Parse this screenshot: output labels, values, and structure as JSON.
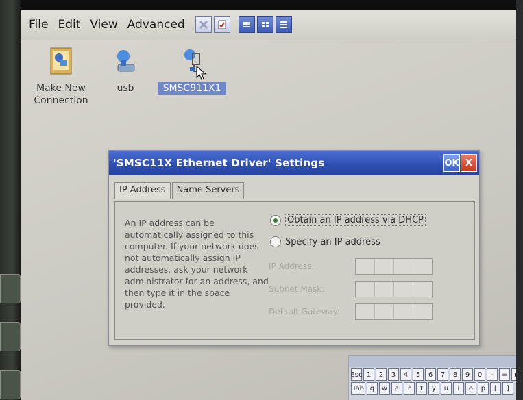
{
  "menubar": {
    "items": [
      "File",
      "Edit",
      "View",
      "Advanced"
    ]
  },
  "toolbar": {
    "buttons": [
      "delete-icon",
      "properties-icon",
      "large-icons-view-icon",
      "small-icons-view-icon",
      "details-view-icon"
    ]
  },
  "desktop_icons": [
    {
      "label": "Make New Connection",
      "icon": "make-new-connection-icon",
      "selected": false
    },
    {
      "label": "usb",
      "icon": "usb-connection-icon",
      "selected": false
    },
    {
      "label": "SMSC911X1",
      "icon": "network-adapter-icon",
      "selected": true
    }
  ],
  "dialog": {
    "title": "'SMSC11X Ethernet Driver' Settings",
    "ok_label": "OK",
    "close_label": "X",
    "tabs": [
      "IP Address",
      "Name Servers"
    ],
    "active_tab": "IP Address",
    "description": "An IP address can be automatically assigned to this computer.  If your network does not automatically assign IP addresses, ask your network administrator for an address, and then type it in the space provided.",
    "options": [
      {
        "label": "Obtain an IP address via DHCP",
        "selected": true
      },
      {
        "label": "Specify an IP address",
        "selected": false
      }
    ],
    "fields": [
      {
        "label": "IP Address:",
        "value": ""
      },
      {
        "label": "Subnet Mask:",
        "value": ""
      },
      {
        "label": "Default Gateway:",
        "value": ""
      }
    ]
  },
  "keyboard": {
    "row1": [
      "Esc",
      "1",
      "2",
      "3",
      "4",
      "5",
      "6",
      "7",
      "8",
      "9",
      "0",
      "-",
      "=",
      "◆"
    ],
    "row2": [
      "Tab",
      "q",
      "w",
      "e",
      "r",
      "t",
      "y",
      "u",
      "i",
      "o",
      "p",
      "[",
      "]"
    ]
  }
}
